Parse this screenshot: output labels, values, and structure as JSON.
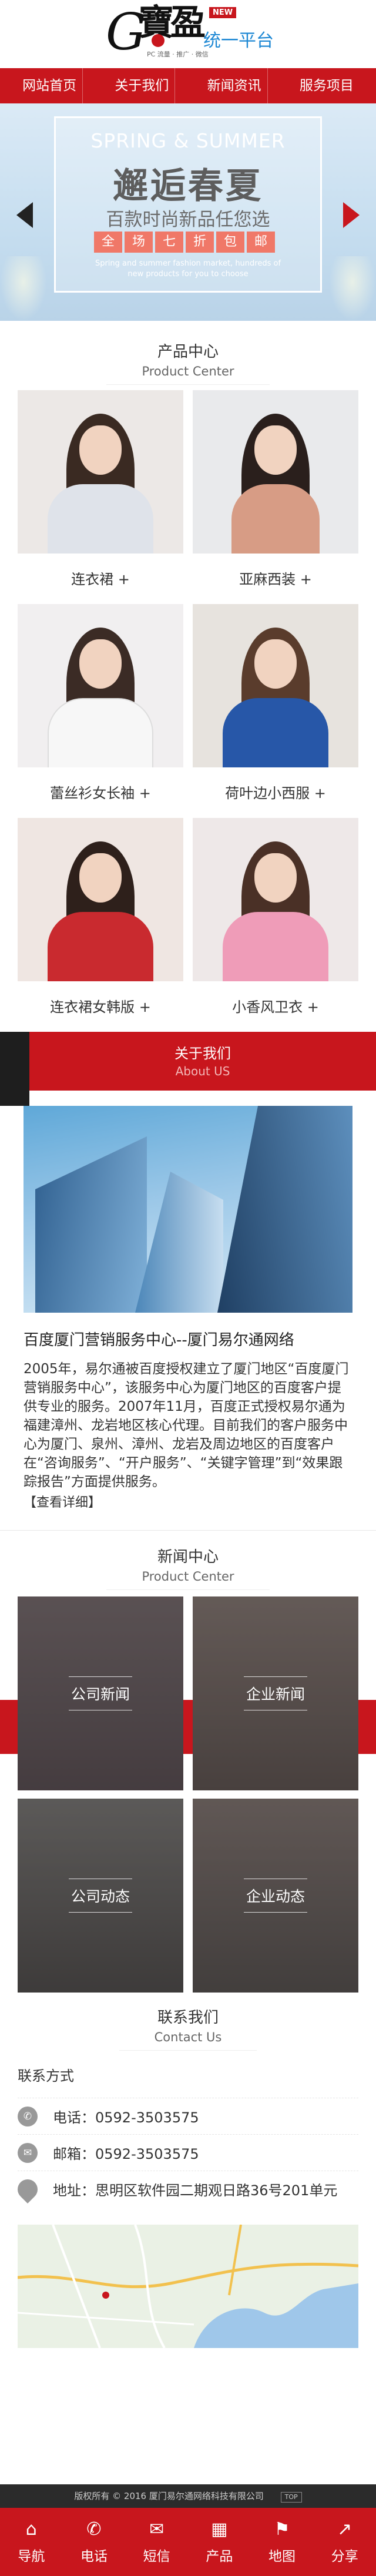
{
  "header": {
    "logo_text": "G寶盈",
    "logo_tagline": "PC 流量 · 推广 · 微信",
    "badge_new": "NEW",
    "platform": "统一平台"
  },
  "nav": {
    "items": [
      {
        "label": "网站首页"
      },
      {
        "label": "关于我们"
      },
      {
        "label": "新闻资讯"
      },
      {
        "label": "服务项目"
      }
    ]
  },
  "banner": {
    "subtitle": "SPRING & SUMMER",
    "title": "邂逅春夏",
    "line": "百款时尚新品任您选",
    "chars": [
      "全",
      "场",
      "七",
      "折",
      "包",
      "邮"
    ],
    "small_text": "Spring and summer fashion market, hundreds of\nnew products for you to choose"
  },
  "products": {
    "title": "产品中心",
    "subtitle": "Product Center",
    "items": [
      {
        "label": "连衣裙 +"
      },
      {
        "label": "亚麻西装 +"
      },
      {
        "label": "蕾丝衫女长袖 +"
      },
      {
        "label": "荷叶边小西服 +"
      },
      {
        "label": "连衣裙女韩版 +"
      },
      {
        "label": "小香风卫衣 +"
      }
    ]
  },
  "about": {
    "title": "关于我们",
    "subtitle": "About US",
    "headline": "百度厦门营销服务中心--厦门易尔通网络",
    "body": "2005年，易尔通被百度授权建立了厦门地区“百度厦门营销服务中心”，该服务中心为厦门地区的百度客户提供专业的服务。2007年11月，百度正式授权易尔通为福建漳州、龙岩地区核心代理。目前我们的客户服务中心为厦门、泉州、漳州、龙岩及周边地区的百度客户在“咨询服务”、“开户服务”、“关键字管理”到“效果跟踪报告”方面提供服务。",
    "more": "【查看详细】"
  },
  "news": {
    "title": "新闻中心",
    "subtitle": "Product Center",
    "cards": [
      {
        "label": "公司新闻"
      },
      {
        "label": "企业新闻"
      },
      {
        "label": "公司动态"
      },
      {
        "label": "企业动态"
      }
    ]
  },
  "contact": {
    "title": "联系我们",
    "subtitle": "Contact Us",
    "heading": "联系方式",
    "phone": "电话：0592-3503575",
    "email": "邮箱：0592-3503575",
    "address": "地址：思明区软件园二期观日路36号201单元"
  },
  "footer": {
    "copyright": "版权所有 © 2016 厦门易尔通网络科技有限公司",
    "badge": "TOP"
  },
  "bottom_nav": {
    "items": [
      {
        "label": "导航",
        "icon": "home-icon"
      },
      {
        "label": "电话",
        "icon": "phone-icon"
      },
      {
        "label": "短信",
        "icon": "mail-icon"
      },
      {
        "label": "产品",
        "icon": "product-icon"
      },
      {
        "label": "地图",
        "icon": "map-icon"
      },
      {
        "label": "分享",
        "icon": "share-icon"
      }
    ]
  },
  "colors": {
    "brand_red": "#c8161d",
    "accent_blue": "#1e88d4",
    "dark": "#1e1e1e"
  }
}
